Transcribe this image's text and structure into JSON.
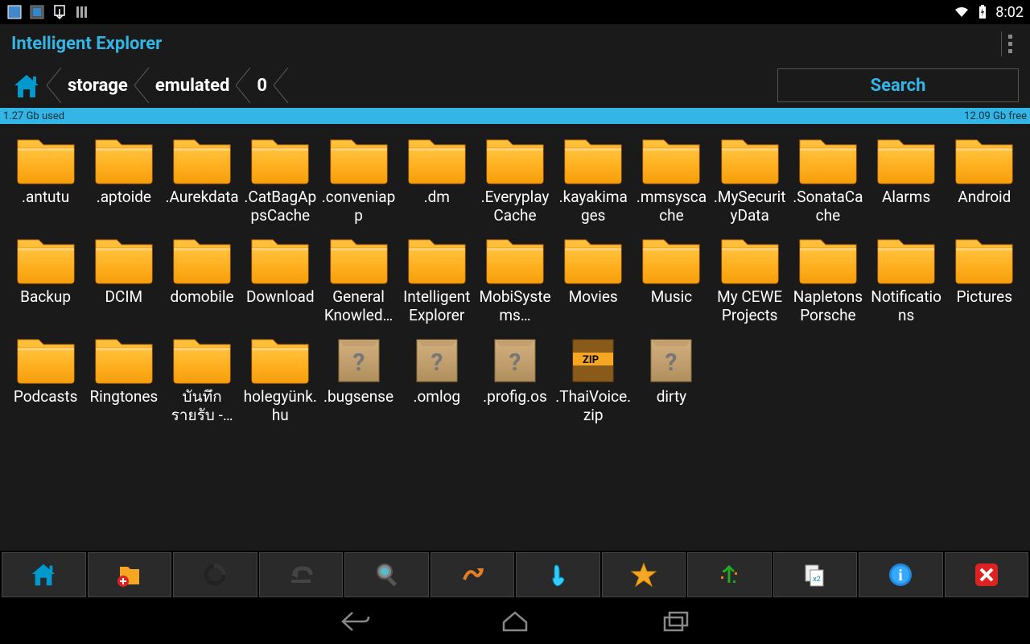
{
  "status": {
    "time": "8:02"
  },
  "app": {
    "title": "Intelligent Explorer"
  },
  "breadcrumbs": [
    "storage",
    "emulated",
    "0"
  ],
  "search": {
    "label": "Search"
  },
  "storage": {
    "used": "1.27 Gb used",
    "free": "12.09 Gb free"
  },
  "files": [
    {
      "name": ".antutu",
      "type": "folder"
    },
    {
      "name": ".aptoide",
      "type": "folder"
    },
    {
      "name": ".Aurekdata",
      "type": "folder"
    },
    {
      "name": ".CatBagAppsCache",
      "type": "folder"
    },
    {
      "name": ".conveniapp",
      "type": "folder"
    },
    {
      "name": ".dm",
      "type": "folder"
    },
    {
      "name": ".EveryplayCache",
      "type": "folder"
    },
    {
      "name": ".kayakimages",
      "type": "folder"
    },
    {
      "name": ".mmsyscache",
      "type": "folder"
    },
    {
      "name": ".MySecurityData",
      "type": "folder"
    },
    {
      "name": ".SonataCache",
      "type": "folder"
    },
    {
      "name": "Alarms",
      "type": "folder"
    },
    {
      "name": "Android",
      "type": "folder"
    },
    {
      "name": "Backup",
      "type": "folder"
    },
    {
      "name": "DCIM",
      "type": "folder"
    },
    {
      "name": "domobile",
      "type": "folder"
    },
    {
      "name": "Download",
      "type": "folder"
    },
    {
      "name": "General Knowled…",
      "type": "folder"
    },
    {
      "name": "Intelligent Explorer",
      "type": "folder"
    },
    {
      "name": "MobiSystems…",
      "type": "folder"
    },
    {
      "name": "Movies",
      "type": "folder"
    },
    {
      "name": "Music",
      "type": "folder"
    },
    {
      "name": "My CEWE Projects",
      "type": "folder"
    },
    {
      "name": "Napletons Porsche",
      "type": "folder"
    },
    {
      "name": "Notifications",
      "type": "folder"
    },
    {
      "name": "Pictures",
      "type": "folder"
    },
    {
      "name": "Podcasts",
      "type": "folder"
    },
    {
      "name": "Ringtones",
      "type": "folder"
    },
    {
      "name": "บันทึกรายรับ -…",
      "type": "folder"
    },
    {
      "name": "holegyünk.hu",
      "type": "folder"
    },
    {
      "name": ".bugsense",
      "type": "unknown"
    },
    {
      "name": ".omlog",
      "type": "unknown"
    },
    {
      "name": ".profig.os",
      "type": "unknown"
    },
    {
      "name": ".ThaiVoice.zip",
      "type": "zip"
    },
    {
      "name": "dirty",
      "type": "unknown"
    }
  ],
  "toolbar": [
    {
      "id": "home"
    },
    {
      "id": "new-folder"
    },
    {
      "id": "refresh"
    },
    {
      "id": "back"
    },
    {
      "id": "search"
    },
    {
      "id": "sort"
    },
    {
      "id": "select"
    },
    {
      "id": "favorite"
    },
    {
      "id": "upload"
    },
    {
      "id": "copy"
    },
    {
      "id": "info"
    },
    {
      "id": "close"
    }
  ]
}
